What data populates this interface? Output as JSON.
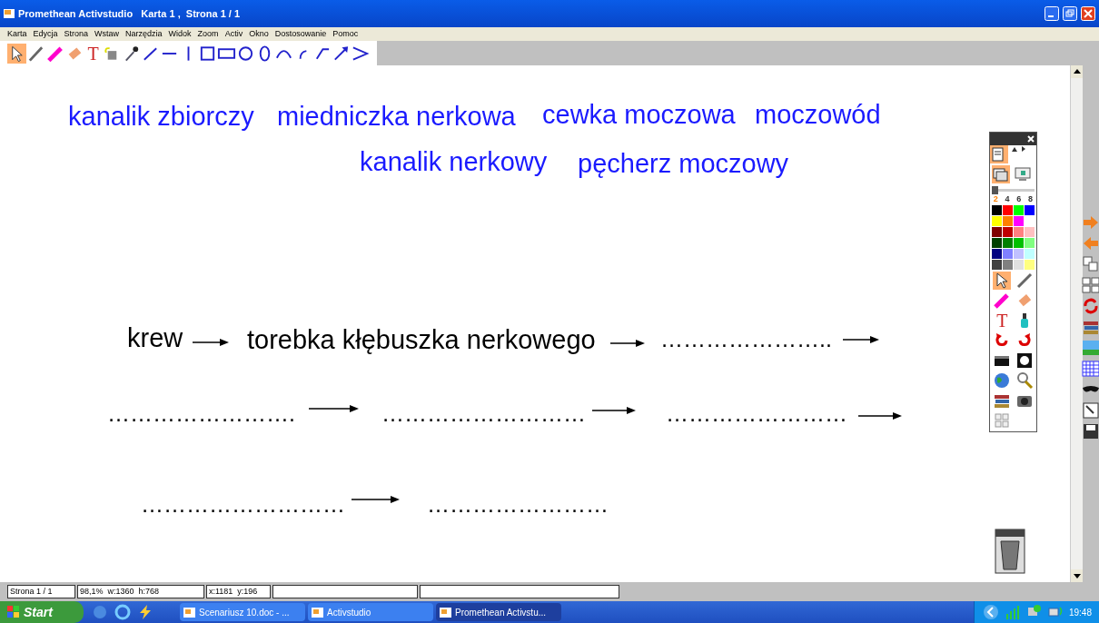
{
  "window": {
    "title": "Promethean Activstudio   Karta 1 ,  Strona 1 / 1"
  },
  "toolbar": {
    "text_tool": "T"
  },
  "menu": [
    "Karta",
    "Edycja",
    "Strona",
    "Wstaw",
    "Narzędzia",
    "Widok",
    "Zoom",
    "Activ",
    "Okno",
    "Dostosowanie",
    "Pomoc"
  ],
  "canvas": {
    "words": [
      {
        "text": "kanalik zbiorczy",
        "color": "#1a1aff"
      },
      {
        "text": "miedniczka nerkowa",
        "color": "#1a1aff"
      },
      {
        "text": "cewka moczowa",
        "color": "#1a1aff"
      },
      {
        "text": "moczowód",
        "color": "#1a1aff"
      },
      {
        "text": "kanalik nerkowy",
        "color": "#1a1aff"
      },
      {
        "text": "pęcherz moczowy",
        "color": "#1a1aff"
      }
    ],
    "chain": [
      {
        "kind": "text",
        "text": "krew"
      },
      {
        "kind": "arrow"
      },
      {
        "kind": "text",
        "text": "torebka kłębuszka nerkowego"
      },
      {
        "kind": "arrow"
      },
      {
        "kind": "blank",
        "text": "………………….."
      },
      {
        "kind": "arrow"
      },
      {
        "kind": "blank",
        "text": "……………………."
      },
      {
        "kind": "arrow"
      },
      {
        "kind": "blank",
        "text": "………………………"
      },
      {
        "kind": "arrow"
      },
      {
        "kind": "blank",
        "text": "……………………"
      },
      {
        "kind": "arrow"
      },
      {
        "kind": "blank",
        "text": "………………………"
      },
      {
        "kind": "arrow"
      },
      {
        "kind": "blank",
        "text": "……………………"
      }
    ]
  },
  "palette": {
    "pen_sizes": [
      {
        "label": "2",
        "selected": true
      },
      {
        "label": "4",
        "selected": false
      },
      {
        "label": "6",
        "selected": false
      },
      {
        "label": "8",
        "selected": false
      }
    ],
    "colors": [
      {
        "color": "#000000"
      },
      {
        "color": "#ff0000"
      },
      {
        "color": "#00ff00"
      },
      {
        "color": "#0000ff"
      },
      {
        "color": "#ffff00"
      },
      {
        "color": "#ff8000"
      },
      {
        "color": "#ff00ff"
      },
      {
        "color": "#800000"
      },
      {
        "color": "#c00000"
      },
      {
        "color": "#ff8080"
      },
      {
        "color": "#ffc0c0"
      },
      {
        "color": "#004000"
      },
      {
        "color": "#008000"
      },
      {
        "color": "#00c000"
      },
      {
        "color": "#80ff80"
      },
      {
        "color": "#000080"
      },
      {
        "color": "#8080ff"
      },
      {
        "color": "#c0c0ff"
      },
      {
        "color": "#c0ffff"
      },
      {
        "color": "#404040"
      },
      {
        "color": "#808080"
      },
      {
        "color": "#e0e0e0"
      },
      {
        "color": "#ffff80"
      }
    ],
    "slider": {
      "level": 0
    },
    "text_tool": "T"
  },
  "status_bar": [
    "Strona 1 / 1",
    "98,1%  w:1360  h:768",
    "x:1181  y:196"
  ],
  "taskbar": {
    "start": "Start",
    "tasks": [
      {
        "label": "Scenariusz 10.doc - ...",
        "selected": false
      },
      {
        "label": "Activstudio",
        "selected": false
      },
      {
        "label": "Promethean Activstu...",
        "selected": true
      }
    ],
    "clock": "19:48"
  }
}
